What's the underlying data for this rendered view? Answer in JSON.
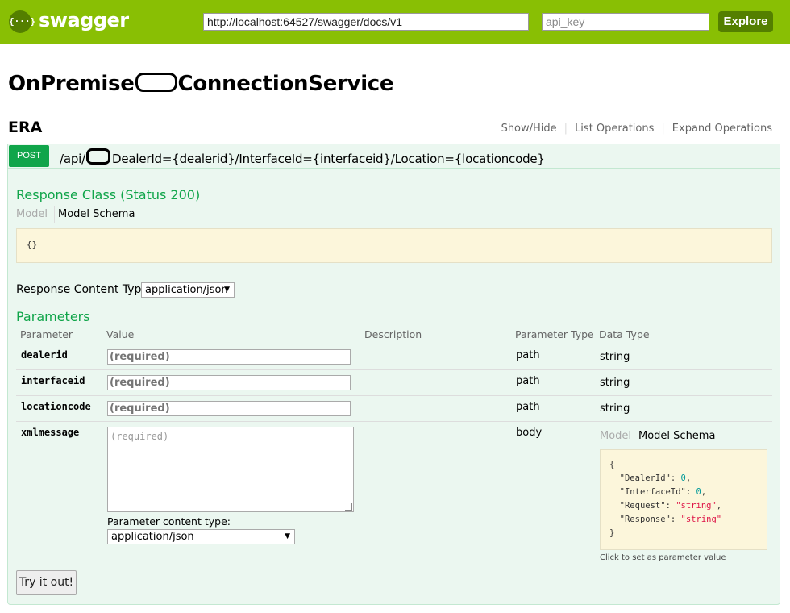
{
  "header": {
    "logo_glyph": "{···}",
    "logo_text": "swagger",
    "url_value": "http://localhost:64527/swagger/docs/v1",
    "api_key_placeholder": "api_key",
    "explore_label": "Explore",
    "brand_color": "#89bf04"
  },
  "api": {
    "title_prefix": "OnPremise",
    "title_suffix": "ConnectionService"
  },
  "resource": {
    "name": "ERA",
    "links": [
      "Show/Hide",
      "List Operations",
      "Expand Operations"
    ]
  },
  "operation": {
    "method": "POST",
    "path_prefix": "/api/",
    "path_suffix": "DealerId={dealerid}/InterfaceId={interfaceid}/Location={locationcode}",
    "response_class_title": "Response Class (Status 200)",
    "model_tab": "Model",
    "model_schema_tab": "Model Schema",
    "response_schema": "{}",
    "response_content_type_label": "Response Content Type",
    "response_content_type_value": "application/json",
    "parameters_title": "Parameters",
    "columns": [
      "Parameter",
      "Value",
      "Description",
      "Parameter Type",
      "Data Type"
    ],
    "params": [
      {
        "name": "dealerid",
        "placeholder": "(required)",
        "param_type": "path",
        "data_type": "string"
      },
      {
        "name": "interfaceid",
        "placeholder": "(required)",
        "param_type": "path",
        "data_type": "string"
      },
      {
        "name": "locationcode",
        "placeholder": "(required)",
        "param_type": "path",
        "data_type": "string"
      },
      {
        "name": "xmlmessage",
        "placeholder": "(required)",
        "param_type": "body"
      }
    ],
    "body_model_tab": "Model",
    "body_model_schema_tab": "Model Schema",
    "body_schema": {
      "open": "{",
      "fields": [
        {
          "key": "\"DealerId\"",
          "value": "0",
          "kind": "num",
          "trail": ","
        },
        {
          "key": "\"InterfaceId\"",
          "value": "0",
          "kind": "num",
          "trail": ","
        },
        {
          "key": "\"Request\"",
          "value": "\"string\"",
          "kind": "str",
          "trail": ","
        },
        {
          "key": "\"Response\"",
          "value": "\"string\"",
          "kind": "str",
          "trail": ""
        }
      ],
      "close": "}"
    },
    "click_hint": "Click to set as parameter value",
    "param_content_type_label": "Parameter content type:",
    "param_content_type_value": "application/json",
    "try_label": "Try it out!"
  }
}
